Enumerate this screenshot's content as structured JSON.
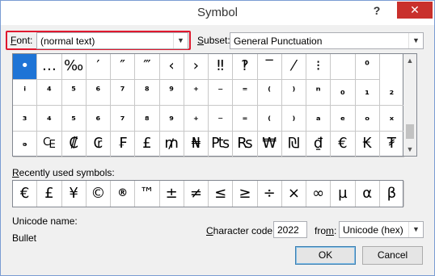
{
  "window": {
    "title": "Symbol",
    "help_label": "?",
    "close_label": "✕"
  },
  "font": {
    "label_accel": "F",
    "label_rest": "ont:",
    "value": "(normal text)"
  },
  "subset": {
    "label_accel": "S",
    "label_rest": "ubset:",
    "value": "General Punctuation"
  },
  "grid": {
    "rows": [
      [
        "•",
        "…",
        "‰",
        "′",
        "″",
        "‴",
        "‹",
        "›",
        "‼",
        "‽",
        "‾",
        "⁄",
        "⁝",
        "",
        "⁰"
      ],
      [
        "ⁱ",
        "⁴",
        "⁵",
        "⁶",
        "⁷",
        "⁸",
        "⁹",
        "⁺",
        "⁻",
        "⁼",
        "⁽",
        "⁾",
        "ⁿ",
        "₀",
        "₁",
        "₂"
      ],
      [
        "₃",
        "₄",
        "₅",
        "₆",
        "₇",
        "₈",
        "₉",
        "₊",
        "₋",
        "₌",
        "₍",
        "₎",
        "ₐ",
        "ₑ",
        "ₒ",
        "ₓ"
      ],
      [
        "ₔ",
        "₠",
        "₡",
        "₢",
        "₣",
        "£",
        "₥",
        "₦",
        "₧",
        "₨",
        "₩",
        "₪",
        "₫",
        "€",
        "₭",
        "₮"
      ]
    ],
    "selected": "•"
  },
  "recently_used": {
    "label_accel": "R",
    "label_rest": "ecently used symbols:",
    "symbols": [
      "€",
      "£",
      "¥",
      "©",
      "®",
      "™",
      "±",
      "≠",
      "≤",
      "≥",
      "÷",
      "×",
      "∞",
      "µ",
      "α",
      "β"
    ]
  },
  "unicode_name": {
    "label": "Unicode name:",
    "value": "Bullet"
  },
  "character_code": {
    "label_accel": "C",
    "label_rest": "haracter code:",
    "value": "2022"
  },
  "from": {
    "label_pre": "fro",
    "label_accel": "m",
    "label_post": ":",
    "value": "Unicode (hex)"
  },
  "buttons": {
    "ok": "OK",
    "cancel": "Cancel"
  }
}
